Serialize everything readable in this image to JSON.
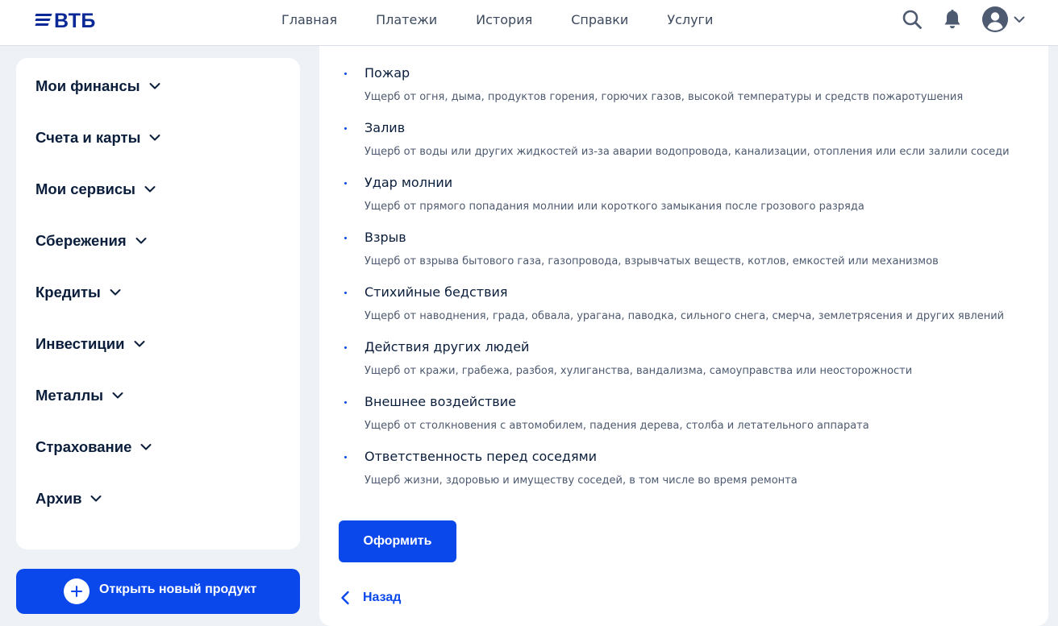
{
  "header": {
    "logo": "ВТБ",
    "nav": [
      "Главная",
      "Платежи",
      "История",
      "Справки",
      "Услуги"
    ],
    "icons": [
      "search-icon",
      "bell-icon",
      "user-avatar-icon",
      "chevron-down-icon"
    ]
  },
  "sidebar": {
    "items": [
      {
        "label": "Мои финансы"
      },
      {
        "label": "Счета и карты"
      },
      {
        "label": "Мои сервисы"
      },
      {
        "label": "Сбережения"
      },
      {
        "label": "Кредиты"
      },
      {
        "label": "Инвестиции"
      },
      {
        "label": "Металлы"
      },
      {
        "label": "Страхование"
      },
      {
        "label": "Архив"
      }
    ],
    "new_product_label": "Открыть новый продукт"
  },
  "main": {
    "risks": [
      {
        "title": "Пожар",
        "desc": "Ущерб от огня, дыма, продуктов горения, горючих газов, высокой температуры и средств пожаротушения"
      },
      {
        "title": "Залив",
        "desc": "Ущерб от воды или других жидкостей из-за аварии водопровода, канализации, отопления или если залили соседи"
      },
      {
        "title": "Удар молнии",
        "desc": "Ущерб от прямого попадания молнии или короткого замыкания после грозового разряда"
      },
      {
        "title": "Взрыв",
        "desc": "Ущерб от взрыва бытового газа, газопровода, взрывчатых веществ, котлов, емкостей или механизмов"
      },
      {
        "title": "Стихийные бедствия",
        "desc": "Ущерб от наводнения, града, обвала, урагана, паводка, сильного снега, смерча, землетрясения и других явлений"
      },
      {
        "title": "Действия других людей",
        "desc": "Ущерб от кражи, грабежа, разбоя, хулиганства, вандализма, самоуправства или неосторожности"
      },
      {
        "title": "Внешнее воздействие",
        "desc": "Ущерб от столкновения с автомобилем, падения дерева, столба и летательного аппарата"
      },
      {
        "title": "Ответственность перед соседями",
        "desc": "Ущерб жизни, здоровью и имуществу соседей, в том числе во время ремонта"
      }
    ],
    "submit_label": "Оформить",
    "back_label": "Назад"
  },
  "colors": {
    "accent": "#0a48eb",
    "brand": "#0a2896",
    "background": "#eef1f6"
  }
}
